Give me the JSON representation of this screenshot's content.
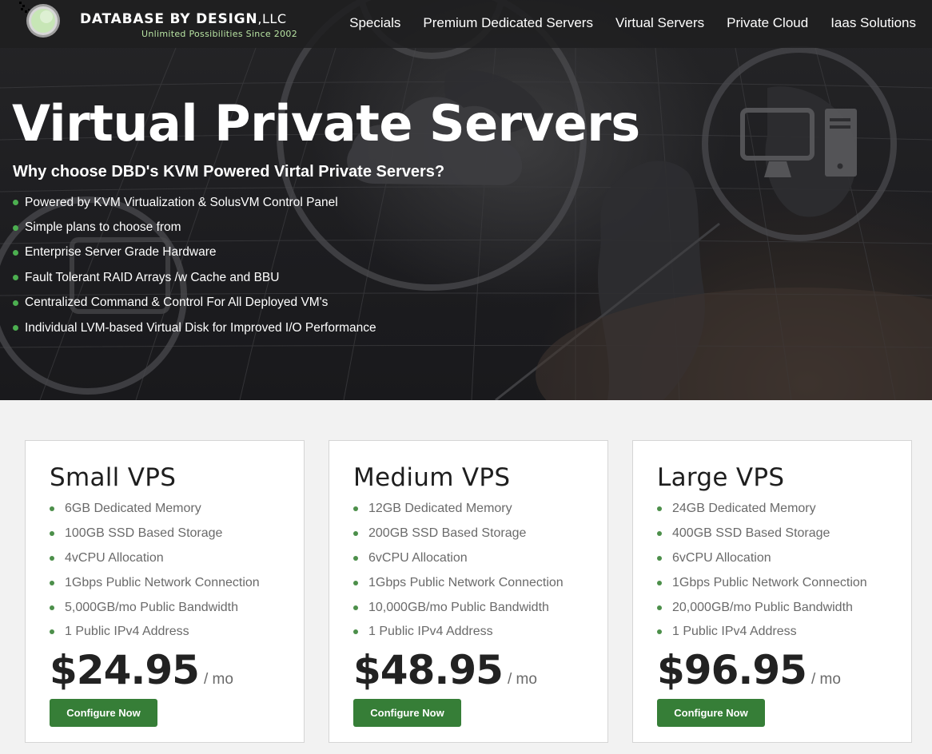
{
  "brand": {
    "name": "DATABASE BY DESIGN",
    "suffix": ",LLC",
    "tagline": "Unlimited Possibilities Since 2002"
  },
  "nav": {
    "items": [
      {
        "label": "Specials"
      },
      {
        "label": "Premium Dedicated Servers"
      },
      {
        "label": "Virtual Servers"
      },
      {
        "label": "Private Cloud"
      },
      {
        "label": "Iaas Solutions"
      }
    ]
  },
  "hero": {
    "title": "Virtual Private Servers",
    "subtitle": "Why choose DBD's KVM Powered Virtal Private Servers?",
    "features": [
      "Powered by KVM Virtualization & SolusVM Control Panel",
      "Simple plans to choose from",
      "Enterprise Server Grade Hardware",
      "Fault Tolerant RAID Arrays /w Cache and BBU",
      "Centralized Command & Control For All Deployed VM's",
      "Individual LVM-based Virtual Disk for Improved I/O Performance"
    ]
  },
  "plans": [
    {
      "name": "Small VPS",
      "features": [
        "6GB Dedicated Memory",
        "100GB SSD Based Storage",
        "4vCPU Allocation",
        "1Gbps Public Network Connection",
        "5,000GB/mo Public Bandwidth",
        "1 Public IPv4 Address"
      ],
      "price": "$24.95",
      "period": "/ mo",
      "cta": "Configure Now"
    },
    {
      "name": "Medium VPS",
      "features": [
        "12GB Dedicated Memory",
        "200GB SSD Based Storage",
        "6vCPU Allocation",
        "1Gbps Public Network Connection",
        "10,000GB/mo Public Bandwidth",
        "1 Public IPv4 Address"
      ],
      "price": "$48.95",
      "period": "/ mo",
      "cta": "Configure Now"
    },
    {
      "name": "Large VPS",
      "features": [
        "24GB Dedicated Memory",
        "400GB SSD Based Storage",
        "6vCPU Allocation",
        "1Gbps Public Network Connection",
        "20,000GB/mo Public Bandwidth",
        "1 Public IPv4 Address"
      ],
      "price": "$96.95",
      "period": "/ mo",
      "cta": "Configure Now"
    }
  ],
  "colors": {
    "accent_green": "#367e37",
    "bullet_green": "#4caf50",
    "tagline_green": "#b8e4a3",
    "hero_dark": "#1e1e20",
    "page_bg": "#f2f2f2"
  }
}
